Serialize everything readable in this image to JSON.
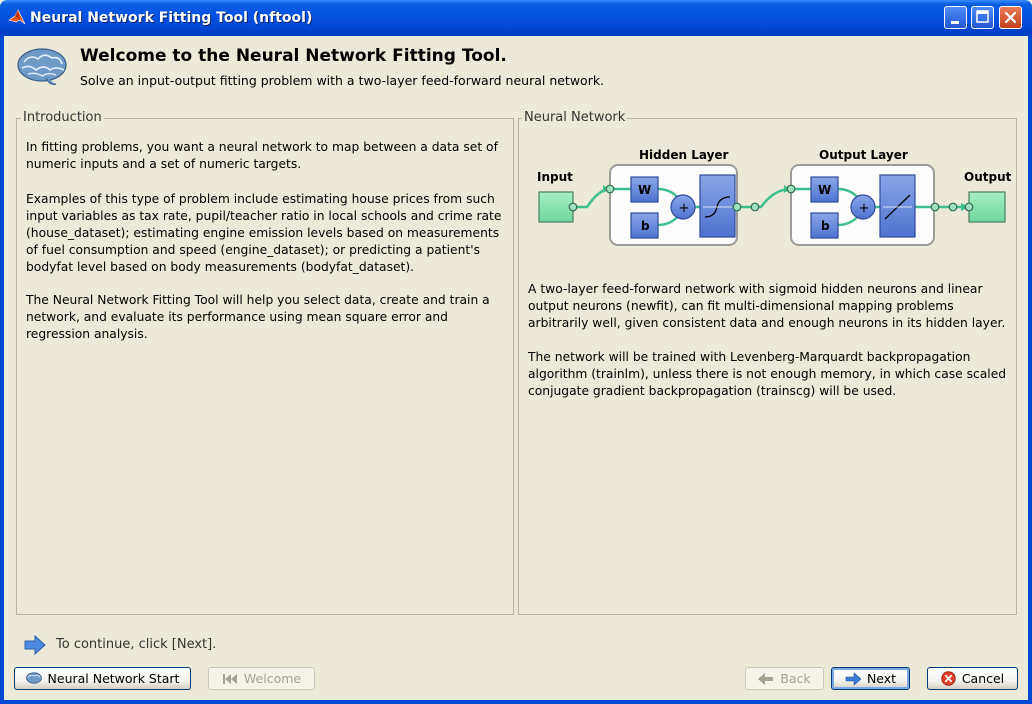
{
  "window": {
    "title": "Neural Network Fitting Tool (nftool)"
  },
  "header": {
    "title": "Welcome to the Neural Network Fitting Tool.",
    "subtitle": "Solve an input-output fitting problem with a two-layer feed-forward neural network."
  },
  "intro": {
    "label": "Introduction",
    "paragraphs": [
      "In fitting problems, you want a neural network to map between a data set of numeric inputs and a set of numeric targets.",
      "Examples of this type of problem include estimating house prices from such input variables as tax rate, pupil/teacher ratio in local schools and crime rate (house_dataset); estimating engine emission levels based on measurements of fuel consumption and speed (engine_dataset); or predicting a patient's bodyfat level based on body measurements (bodyfat_dataset).",
      "The Neural Network Fitting Tool will help you select data, create and train a network, and evaluate its performance using mean square error and regression analysis."
    ]
  },
  "network": {
    "label": "Neural Network",
    "diagram": {
      "input": "Input",
      "hidden": "Hidden Layer",
      "output_layer": "Output Layer",
      "output": "Output",
      "w": "W",
      "b": "b",
      "plus": "+"
    },
    "paragraphs": [
      "A two-layer feed-forward network with sigmoid hidden neurons and linear output neurons (newfit), can fit multi-dimensional mapping problems arbitrarily well, given consistent data and enough neurons in its hidden layer.",
      "The network will be trained with Levenberg-Marquardt backpropagation algorithm (trainlm), unless there is not enough memory, in which case scaled conjugate gradient backpropagation (trainscg) will be used."
    ]
  },
  "hint": "To continue, click [Next].",
  "buttons": {
    "start": "Neural Network Start",
    "welcome": "Welcome",
    "back": "Back",
    "next": "Next",
    "cancel": "Cancel"
  }
}
